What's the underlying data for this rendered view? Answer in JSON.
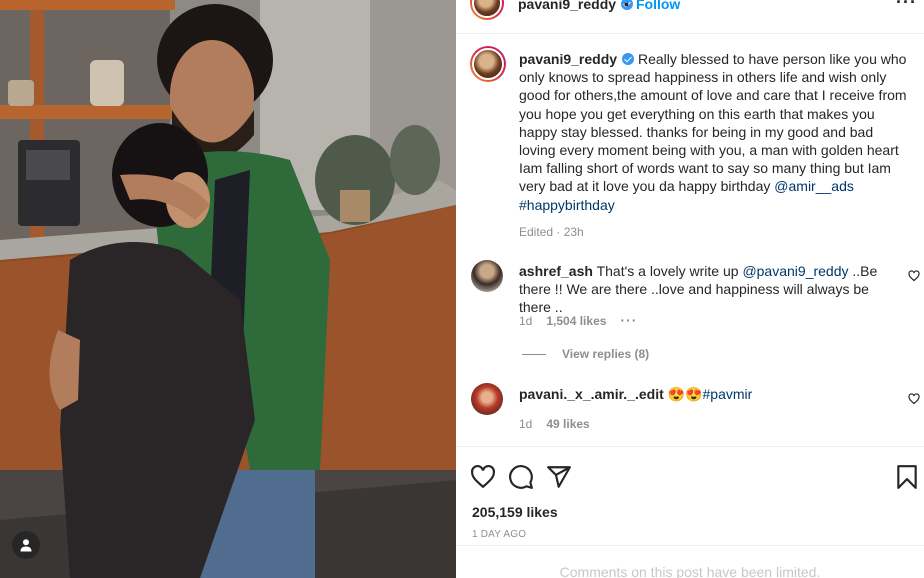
{
  "post": {
    "username": "pavani9_reddy",
    "dot": "•",
    "follow_label": "Follow",
    "more_label": "···",
    "caption": {
      "username": "pavani9_reddy",
      "text": "Really blessed to have person like you who only knows to spread happiness in others life and wish only good for others,the amount of love and care that I receive from you hope you get everything on this earth that makes you happy stay blessed. thanks for being in my good and bad loving every moment being with you, a man with golden heart Iam falling short of words want to say so many thing but Iam very bad at it love you da happy birthday ",
      "mention": "@amir__ads",
      "hashtag": "#happybirthday",
      "edited": "Edited · 23h"
    },
    "comments": [
      {
        "username": "ashref_ash",
        "text_before": "That's a lovely write up ",
        "mention": "@pavani9_reddy",
        "text_after": " ..Be there !! We are there ..love and happiness will always be there ..",
        "age": "1d",
        "likes": "1,504 likes",
        "more": "···",
        "view_replies": "View replies (8)"
      },
      {
        "username": "pavani._x_.amir._.edit",
        "emojis": "😍😍",
        "hashtag": "#pavmir",
        "age": "1d",
        "likes": "49 likes"
      }
    ],
    "likes_count": "205,159 likes",
    "time_ago": "1 DAY AGO",
    "comments_limited": "Comments on this post have been limited."
  },
  "colors": {
    "accent": "#0095f6",
    "link": "#00376b",
    "muted": "#8e8e8e",
    "verified": "#3897f0"
  },
  "icons": [
    "user-tag-icon",
    "more-icon",
    "heart-icon",
    "comment-icon",
    "share-icon",
    "bookmark-icon",
    "verified-badge-icon"
  ]
}
